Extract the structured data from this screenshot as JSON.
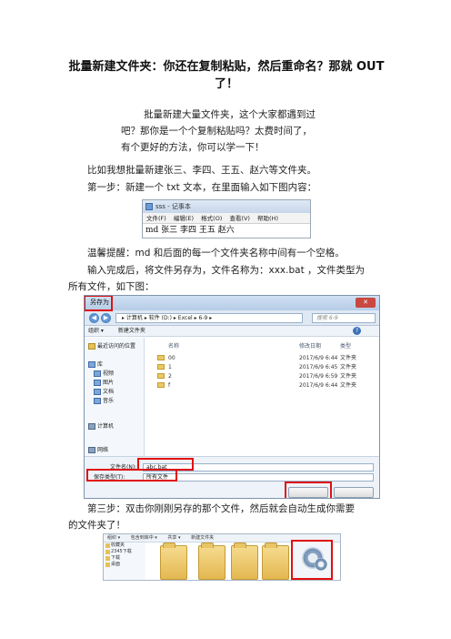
{
  "title_line1": "批量新建文件夹：你还在复制粘贴，然后重命名？那就 OUT",
  "title_line2": "了！",
  "intro": [
    "批量新建大量文件夹，这个大家都遇到过",
    "吧？那你是一个个复制粘贴吗？太费时间了，",
    "有个更好的方法，你可以学一下！"
  ],
  "example": "比如我想批量新建张三、李四、王五、赵六等文件夹。",
  "step1": "第一步：新建一个 txt 文本，在里面输入如下图内容：",
  "notepad": {
    "title": "sss - 记事本",
    "menu": [
      "文件(F)",
      "编辑(E)",
      "格式(O)",
      "查看(V)",
      "帮助(H)"
    ],
    "content": "md 张三 李四 王五 赵六"
  },
  "tip": "温馨提醒：md 和后面的每一个文件夹名称中间有一个空格。",
  "step2_line1": "输入完成后，将文件另存为，文件名称为：xxx.bat ，文件类型为",
  "step2_line2": "所有文件，如下图：",
  "dialog": {
    "title": "另存为",
    "path": "▸ 计算机 ▸ 软件 (D:) ▸ Excel ▸ 6-9 ▸",
    "search_placeholder": "搜索 6-9",
    "toolbar": [
      "组织 ▾",
      "新建文件夹"
    ],
    "nav": [
      {
        "label": "最近访问的位置",
        "kind": "folder"
      },
      {
        "label": "库",
        "kind": "lib"
      },
      {
        "label": "视频",
        "kind": "lib"
      },
      {
        "label": "图片",
        "kind": "lib"
      },
      {
        "label": "文档",
        "kind": "lib"
      },
      {
        "label": "音乐",
        "kind": "lib"
      },
      {
        "label": "计算机",
        "kind": "pc"
      },
      {
        "label": "网络",
        "kind": "pc"
      }
    ],
    "headers": [
      "名称",
      "修改日期",
      "类型"
    ],
    "rows": [
      {
        "name": "00",
        "date": "2017/6/9 6:44",
        "type": "文件夹"
      },
      {
        "name": "1",
        "date": "2017/6/9 6:45",
        "type": "文件夹"
      },
      {
        "name": "2",
        "date": "2017/6/9 6:59",
        "type": "文件夹"
      },
      {
        "name": "f",
        "date": "2017/6/9 6:44",
        "type": "文件夹"
      }
    ],
    "filename_label": "文件名(N):",
    "filename_value": "abc.bat",
    "filetype_label": "保存类型(T):",
    "filetype_value": "所有文件"
  },
  "step3_line1": "第三步：双击你刚刚另存的那个文件，然后就会自动生成你需要",
  "step3_line2": "的文件夹了！",
  "explorer": {
    "toolbar": [
      "组织 ▾",
      "包含到库中 ▾",
      "共享 ▾",
      "新建文件夹"
    ],
    "nav": [
      "收藏夹",
      "2345下载",
      "下载",
      "桌面"
    ]
  }
}
